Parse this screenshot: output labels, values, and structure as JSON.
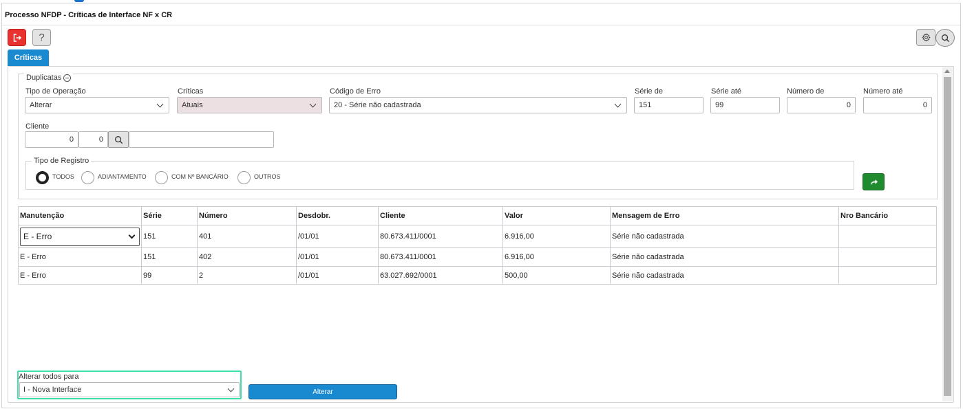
{
  "window": {
    "title": "Processo NFDP - Críticas de Interface NF x CR"
  },
  "toolbar": {
    "exit_icon": "exit-icon",
    "help_label": "?",
    "gear_icon": "gear-icon",
    "search_icon": "search-icon"
  },
  "tabs": [
    {
      "label": "Críticas",
      "active": true
    }
  ],
  "filters": {
    "legend": "Duplicatas",
    "tipo_operacao": {
      "label": "Tipo de Operação",
      "value": "Alterar"
    },
    "criticas": {
      "label": "Críticas",
      "value": "Atuais"
    },
    "codigo_erro": {
      "label": "Código de Erro",
      "value": "20 - Série não cadastrada"
    },
    "serie_de": {
      "label": "Série de",
      "value": "151"
    },
    "serie_ate": {
      "label": "Série até",
      "value": "99"
    },
    "numero_de": {
      "label": "Número de",
      "value": "0"
    },
    "numero_ate": {
      "label": "Número até",
      "value": "0"
    },
    "cliente": {
      "label": "Cliente",
      "code1": "0",
      "code2": "0",
      "name": ""
    },
    "tipo_registro": {
      "legend": "Tipo de Registro",
      "options": [
        "TODOS",
        "ADIANTAMENTO",
        "COM Nº BANCÁRIO",
        "OUTROS"
      ],
      "selected": "TODOS"
    }
  },
  "grid": {
    "headers": [
      "Manutenção",
      "Série",
      "Número",
      "Desdobr.",
      "Cliente",
      "Valor",
      "Mensagem de Erro",
      "Nro Bancário"
    ],
    "rows": [
      [
        "E - Erro",
        "151",
        "401",
        "/01/01",
        "80.673.411/0001",
        "6.916,00",
        "Série não cadastrada",
        ""
      ],
      [
        "E - Erro",
        "151",
        "402",
        "/01/01",
        "80.673.411/0001",
        "6.916,00",
        "Série não cadastrada",
        ""
      ],
      [
        "E - Erro",
        "99",
        "2",
        "/01/01",
        "63.027.692/0001",
        "500,00",
        "Série não cadastrada",
        ""
      ]
    ]
  },
  "bulk": {
    "label": "Alterar todos para",
    "value": "I - Nova Interface",
    "button_label": "Alterar"
  },
  "colors": {
    "primary": "#1a8ad0",
    "danger": "#e8322f",
    "success": "#1f8a2e",
    "focus": "#3ee0a8",
    "disabled_field": "#ece0e3"
  }
}
